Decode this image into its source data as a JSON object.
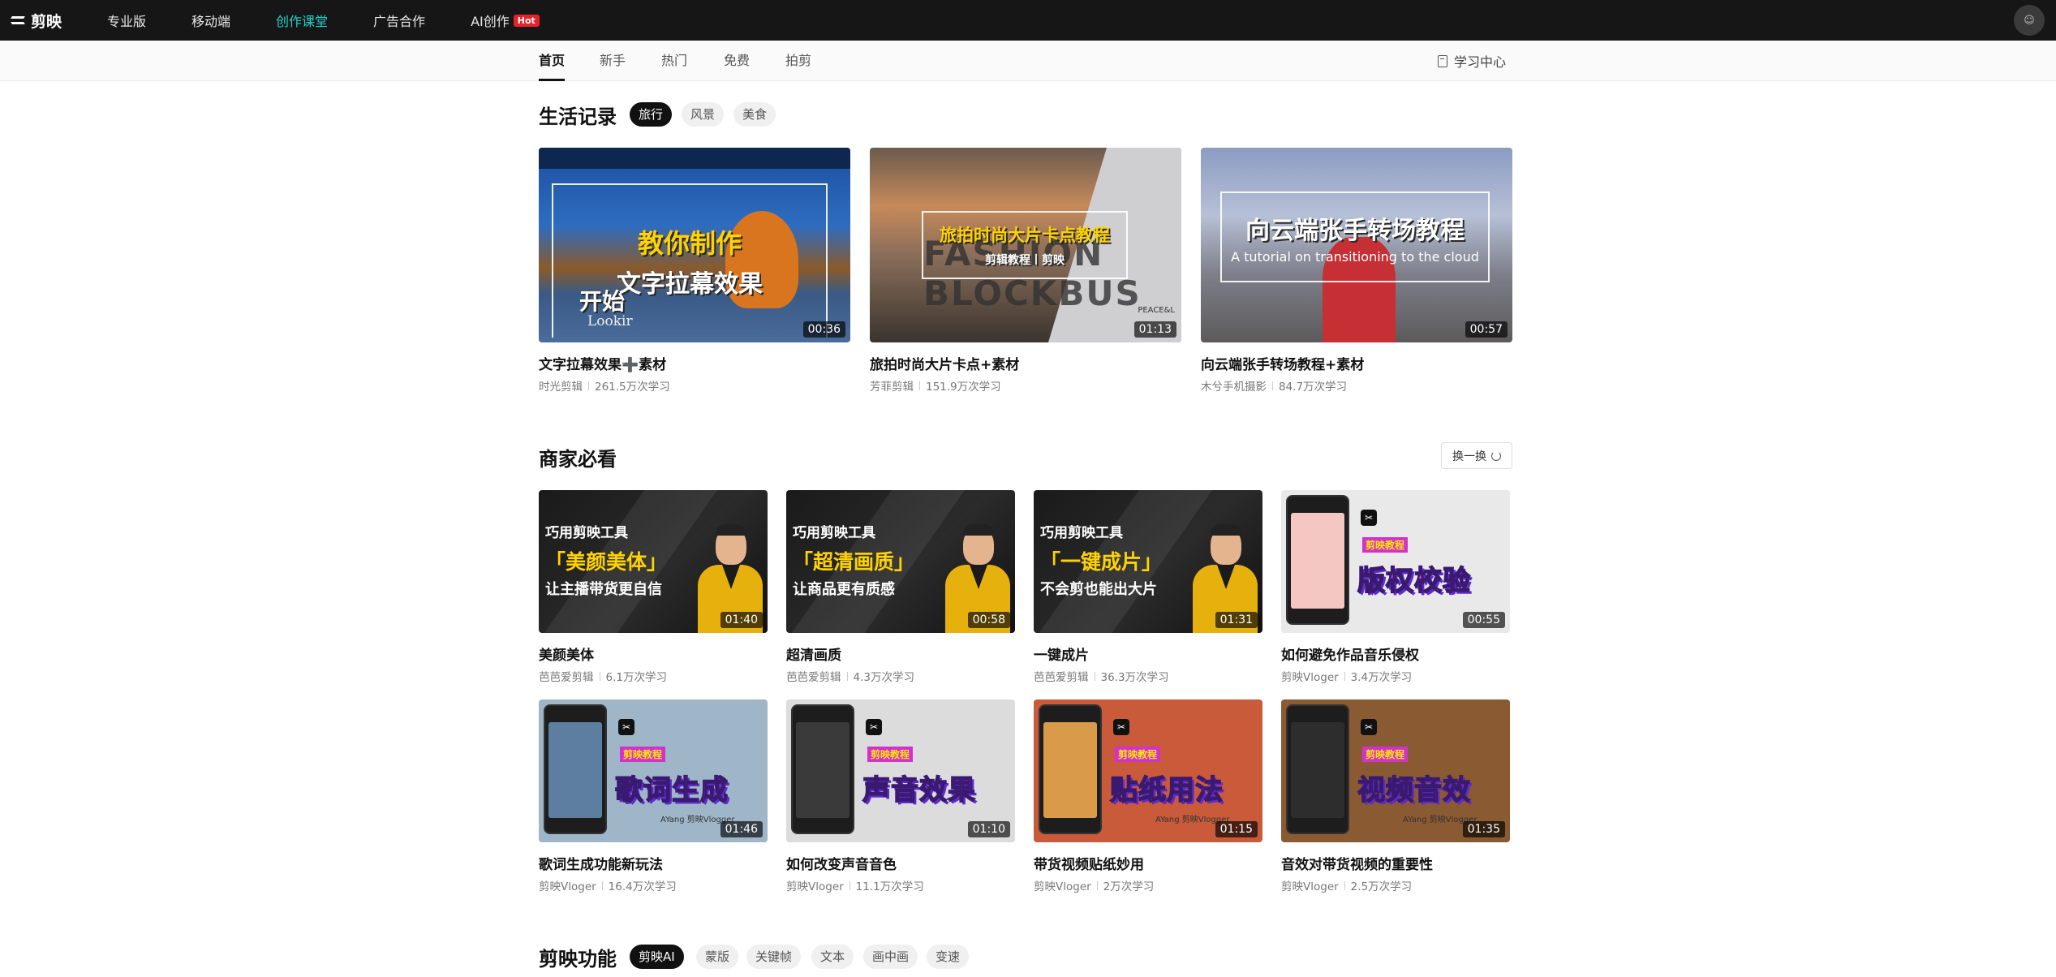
{
  "topnav": {
    "logo_text": "剪映",
    "items": [
      {
        "label": "专业版"
      },
      {
        "label": "移动端"
      },
      {
        "label": "创作课堂",
        "active": true
      },
      {
        "label": "广告合作"
      },
      {
        "label": "AI创作",
        "badge": "Hot"
      }
    ]
  },
  "subnav": {
    "tabs": [
      "首页",
      "新手",
      "热门",
      "免费",
      "拍剪"
    ],
    "active_tab": "首页",
    "study_center": "学习中心"
  },
  "life": {
    "title": "生活记录",
    "chips": [
      "旅行",
      "风景",
      "美食"
    ],
    "active_chip": "旅行",
    "cards": [
      {
        "title": "文字拉幕效果➕素材",
        "author": "时光剪辑",
        "views": "261.5万次学习",
        "duration": "00:36",
        "thumb_l1": "教你制作",
        "thumb_l2": "文字拉幕效果",
        "thumb_l3": "开始",
        "thumb_l4": "Lookir"
      },
      {
        "title": "旅拍时尚大片卡点+素材",
        "author": "芳菲剪辑",
        "views": "151.9万次学习",
        "duration": "01:13",
        "thumb_l1": "旅拍时尚大片卡点教程",
        "thumb_l2": "剪辑教程丨剪映",
        "thumb_bg": "FASHION BLOCKBUS",
        "thumb_corner": "PEACE&L"
      },
      {
        "title": "向云端张手转场教程+素材",
        "author": "木兮手机摄影",
        "views": "84.7万次学习",
        "duration": "00:57",
        "thumb_l1": "向云端张手转场教程",
        "thumb_l2": "A tutorial on transitioning to the cloud"
      }
    ]
  },
  "merchant": {
    "title": "商家必看",
    "refresh_label": "换一换",
    "cards": [
      {
        "title": "美颜美体",
        "author": "芭芭爱剪辑",
        "views": "6.1万次学习",
        "duration": "01:40",
        "type": "biz",
        "l1": "巧用剪映工具",
        "l2": "「美颜美体」",
        "l3": "让主播带货更自信"
      },
      {
        "title": "超清画质",
        "author": "芭芭爱剪辑",
        "views": "4.3万次学习",
        "duration": "00:58",
        "type": "biz",
        "l1": "巧用剪映工具",
        "l2": "「超清画质」",
        "l3": "让商品更有质感"
      },
      {
        "title": "一键成片",
        "author": "芭芭爱剪辑",
        "views": "36.3万次学习",
        "duration": "01:31",
        "type": "biz",
        "l1": "巧用剪映工具",
        "l2": "「一键成片」",
        "l3": "不会剪也能出大片"
      },
      {
        "title": "如何避免作品音乐侵权",
        "author": "剪映Vloger",
        "views": "3.4万次学习",
        "duration": "00:55",
        "type": "vlog",
        "label": "剪映教程",
        "big": "版权校验",
        "bg": "#e9e9e9",
        "screen": "#f4c7c3"
      },
      {
        "title": "歌词生成功能新玩法",
        "author": "剪映Vloger",
        "views": "16.4万次学习",
        "duration": "01:46",
        "type": "vlog",
        "label": "剪映教程",
        "big": "歌词生成",
        "bg": "#9fb6c8",
        "screen": "#5e7ea0",
        "sign": "AYang 剪映Vlogger"
      },
      {
        "title": "如何改变声音音色",
        "author": "剪映Vloger",
        "views": "11.1万次学习",
        "duration": "01:10",
        "type": "vlog",
        "label": "剪映教程",
        "big": "声音效果",
        "bg": "#dcdcdc",
        "screen": "#3a3a3a"
      },
      {
        "title": "带货视频贴纸妙用",
        "author": "剪映Vloger",
        "views": "2万次学习",
        "duration": "01:15",
        "type": "vlog",
        "label": "剪映教程",
        "big": "贴纸用法",
        "bg": "#c95a3a",
        "screen": "#d99a4a",
        "sign": "AYang 剪映Vlogger"
      },
      {
        "title": "音效对带货视频的重要性",
        "author": "剪映Vloger",
        "views": "2.5万次学习",
        "duration": "01:35",
        "type": "vlog",
        "label": "剪映教程",
        "big": "视频音效",
        "bg": "#8a5a32",
        "screen": "#2d2d2d",
        "sign": "AYang 剪映Vlogger"
      }
    ]
  },
  "features": {
    "title": "剪映功能",
    "chips": [
      "剪映AI",
      "蒙版",
      "关键帧",
      "文本",
      "画中画",
      "变速"
    ],
    "active_chip": "剪映AI"
  },
  "colors": {
    "nav_bg": "#161616",
    "accent": "#21d4c8",
    "hot": "#e8212a"
  }
}
